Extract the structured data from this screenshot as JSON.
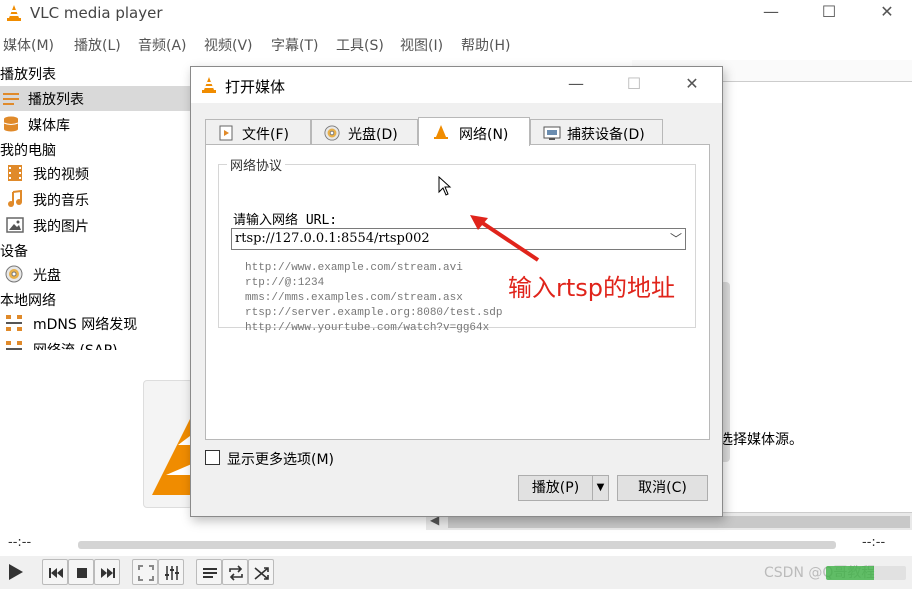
{
  "window": {
    "title": "VLC media player",
    "minimize": "—",
    "maximize": "☐",
    "close": "✕"
  },
  "menubar": [
    "媒体(M)",
    "播放(L)",
    "音频(A)",
    "视频(V)",
    "字幕(T)",
    "工具(S)",
    "视图(I)",
    "帮助(H)"
  ],
  "sidebar": {
    "playlist_header": "播放列表",
    "playlist_item": "播放列表",
    "library_item": "媒体库",
    "my_computer_header": "我的电脑",
    "my_videos": "我的视频",
    "my_music": "我的音乐",
    "my_pictures": "我的图片",
    "devices_header": "设备",
    "disc": "光盘",
    "local_network_header": "本地网络",
    "mdns": "mDNS 网络发现",
    "sap": "网络流 (SAP)"
  },
  "right_panel": {
    "hint_line1": "。",
    "hint_line2": "选择媒体源。"
  },
  "controls": {
    "time_elapsed": "--:--",
    "time_total": "--:--",
    "watermark": "CSDN @Q哥教程"
  },
  "dialog": {
    "title": "打开媒体",
    "minimize": "—",
    "maximize": "☐",
    "close": "✕",
    "tabs": [
      "文件(F)",
      "光盘(D)",
      "网络(N)",
      "捕获设备(D)"
    ],
    "active_tab": "网络(N)",
    "group_title": "网络协议",
    "url_label": "请输入网络 URL:",
    "url_value": "rtsp://127.0.0.1:8554/rtsp002",
    "examples": [
      "http://www.example.com/stream.avi",
      "rtp://@:1234",
      "mms://mms.examples.com/stream.asx",
      "rtsp://server.example.org:8080/test.sdp",
      "http://www.yourtube.com/watch?v=gg64x"
    ],
    "more_options": "显示更多选项(M)",
    "play_button": "播放(P)",
    "cancel_button": "取消(C)"
  },
  "annotation": {
    "text": "输入rtsp的地址",
    "color": "#e0241b"
  },
  "colors": {
    "vlc_orange": "#f08c00",
    "selection_bg": "#d9d9d9"
  }
}
